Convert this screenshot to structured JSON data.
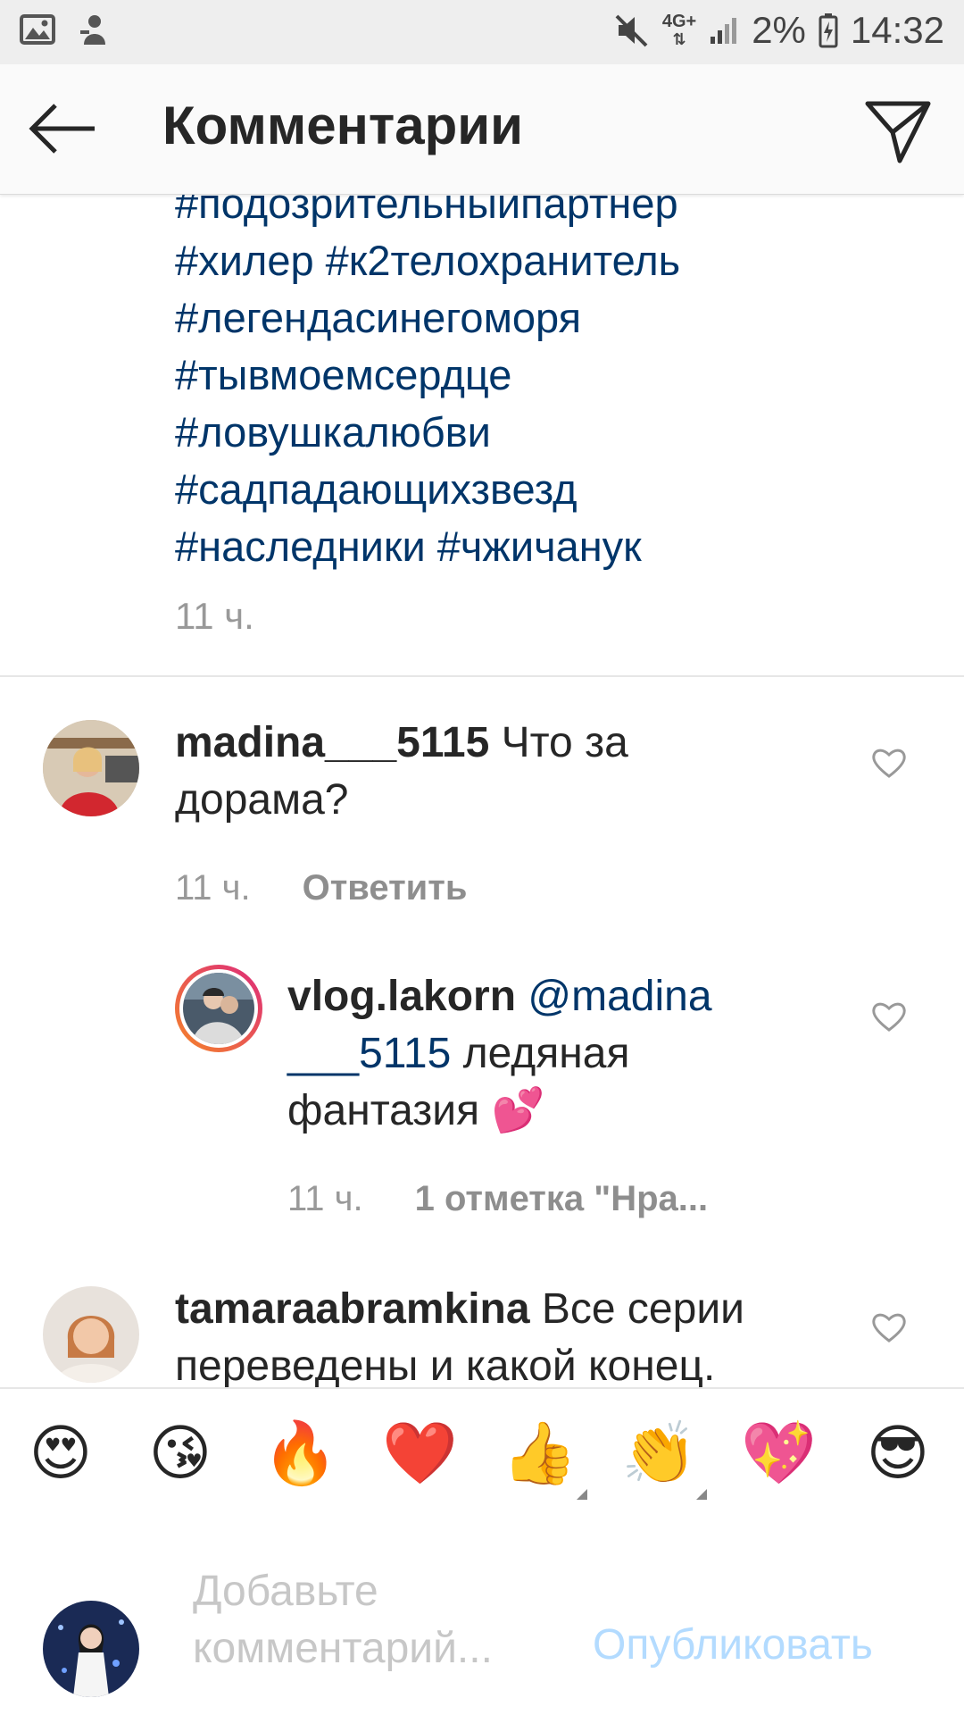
{
  "status_bar": {
    "left_icons": [
      "image-icon",
      "bug-notification-icon"
    ],
    "network": "4G+",
    "battery": "2%",
    "time": "14:32"
  },
  "header": {
    "title": "Комментарии"
  },
  "caption": {
    "hashtags": [
      "#подозрительныйпартнер",
      "#хилер #к2телохранитель",
      "#легендасинегоморя",
      "#тывмоемсердце",
      "#ловушкалюбви",
      "#садпадающихзвезд",
      "#наследники #чжичанук"
    ],
    "time": "11 ч."
  },
  "comments": [
    {
      "username": "madina___5115",
      "text": " Что за",
      "text2": "дорама?",
      "time": "11 ч.",
      "reply_label": "Ответить"
    },
    {
      "username": "vlog.lakorn",
      "mention": " @madina",
      "mention2": "___5115",
      "text": " ледяная",
      "text2": "фантазия 💕",
      "time": "11 ч.",
      "likes_label": "1 отметка \"Нра..."
    },
    {
      "username": "tamaraabramkina",
      "text": " Все серии",
      "text2": "переведены и какой конец."
    }
  ],
  "emoji_bar": [
    "😍",
    "😘",
    "🔥",
    "❤️",
    "👍",
    "👏",
    "💖",
    "😎"
  ],
  "composer": {
    "placeholder_line1": "Добавьте",
    "placeholder_line2": "комментарий...",
    "publish_label": "Опубликовать"
  },
  "colors": {
    "hashtag": "#003569",
    "publish_disabled": "#b3dbff",
    "story_ring_start": "#f58529",
    "story_ring_end": "#dd2a7b"
  }
}
